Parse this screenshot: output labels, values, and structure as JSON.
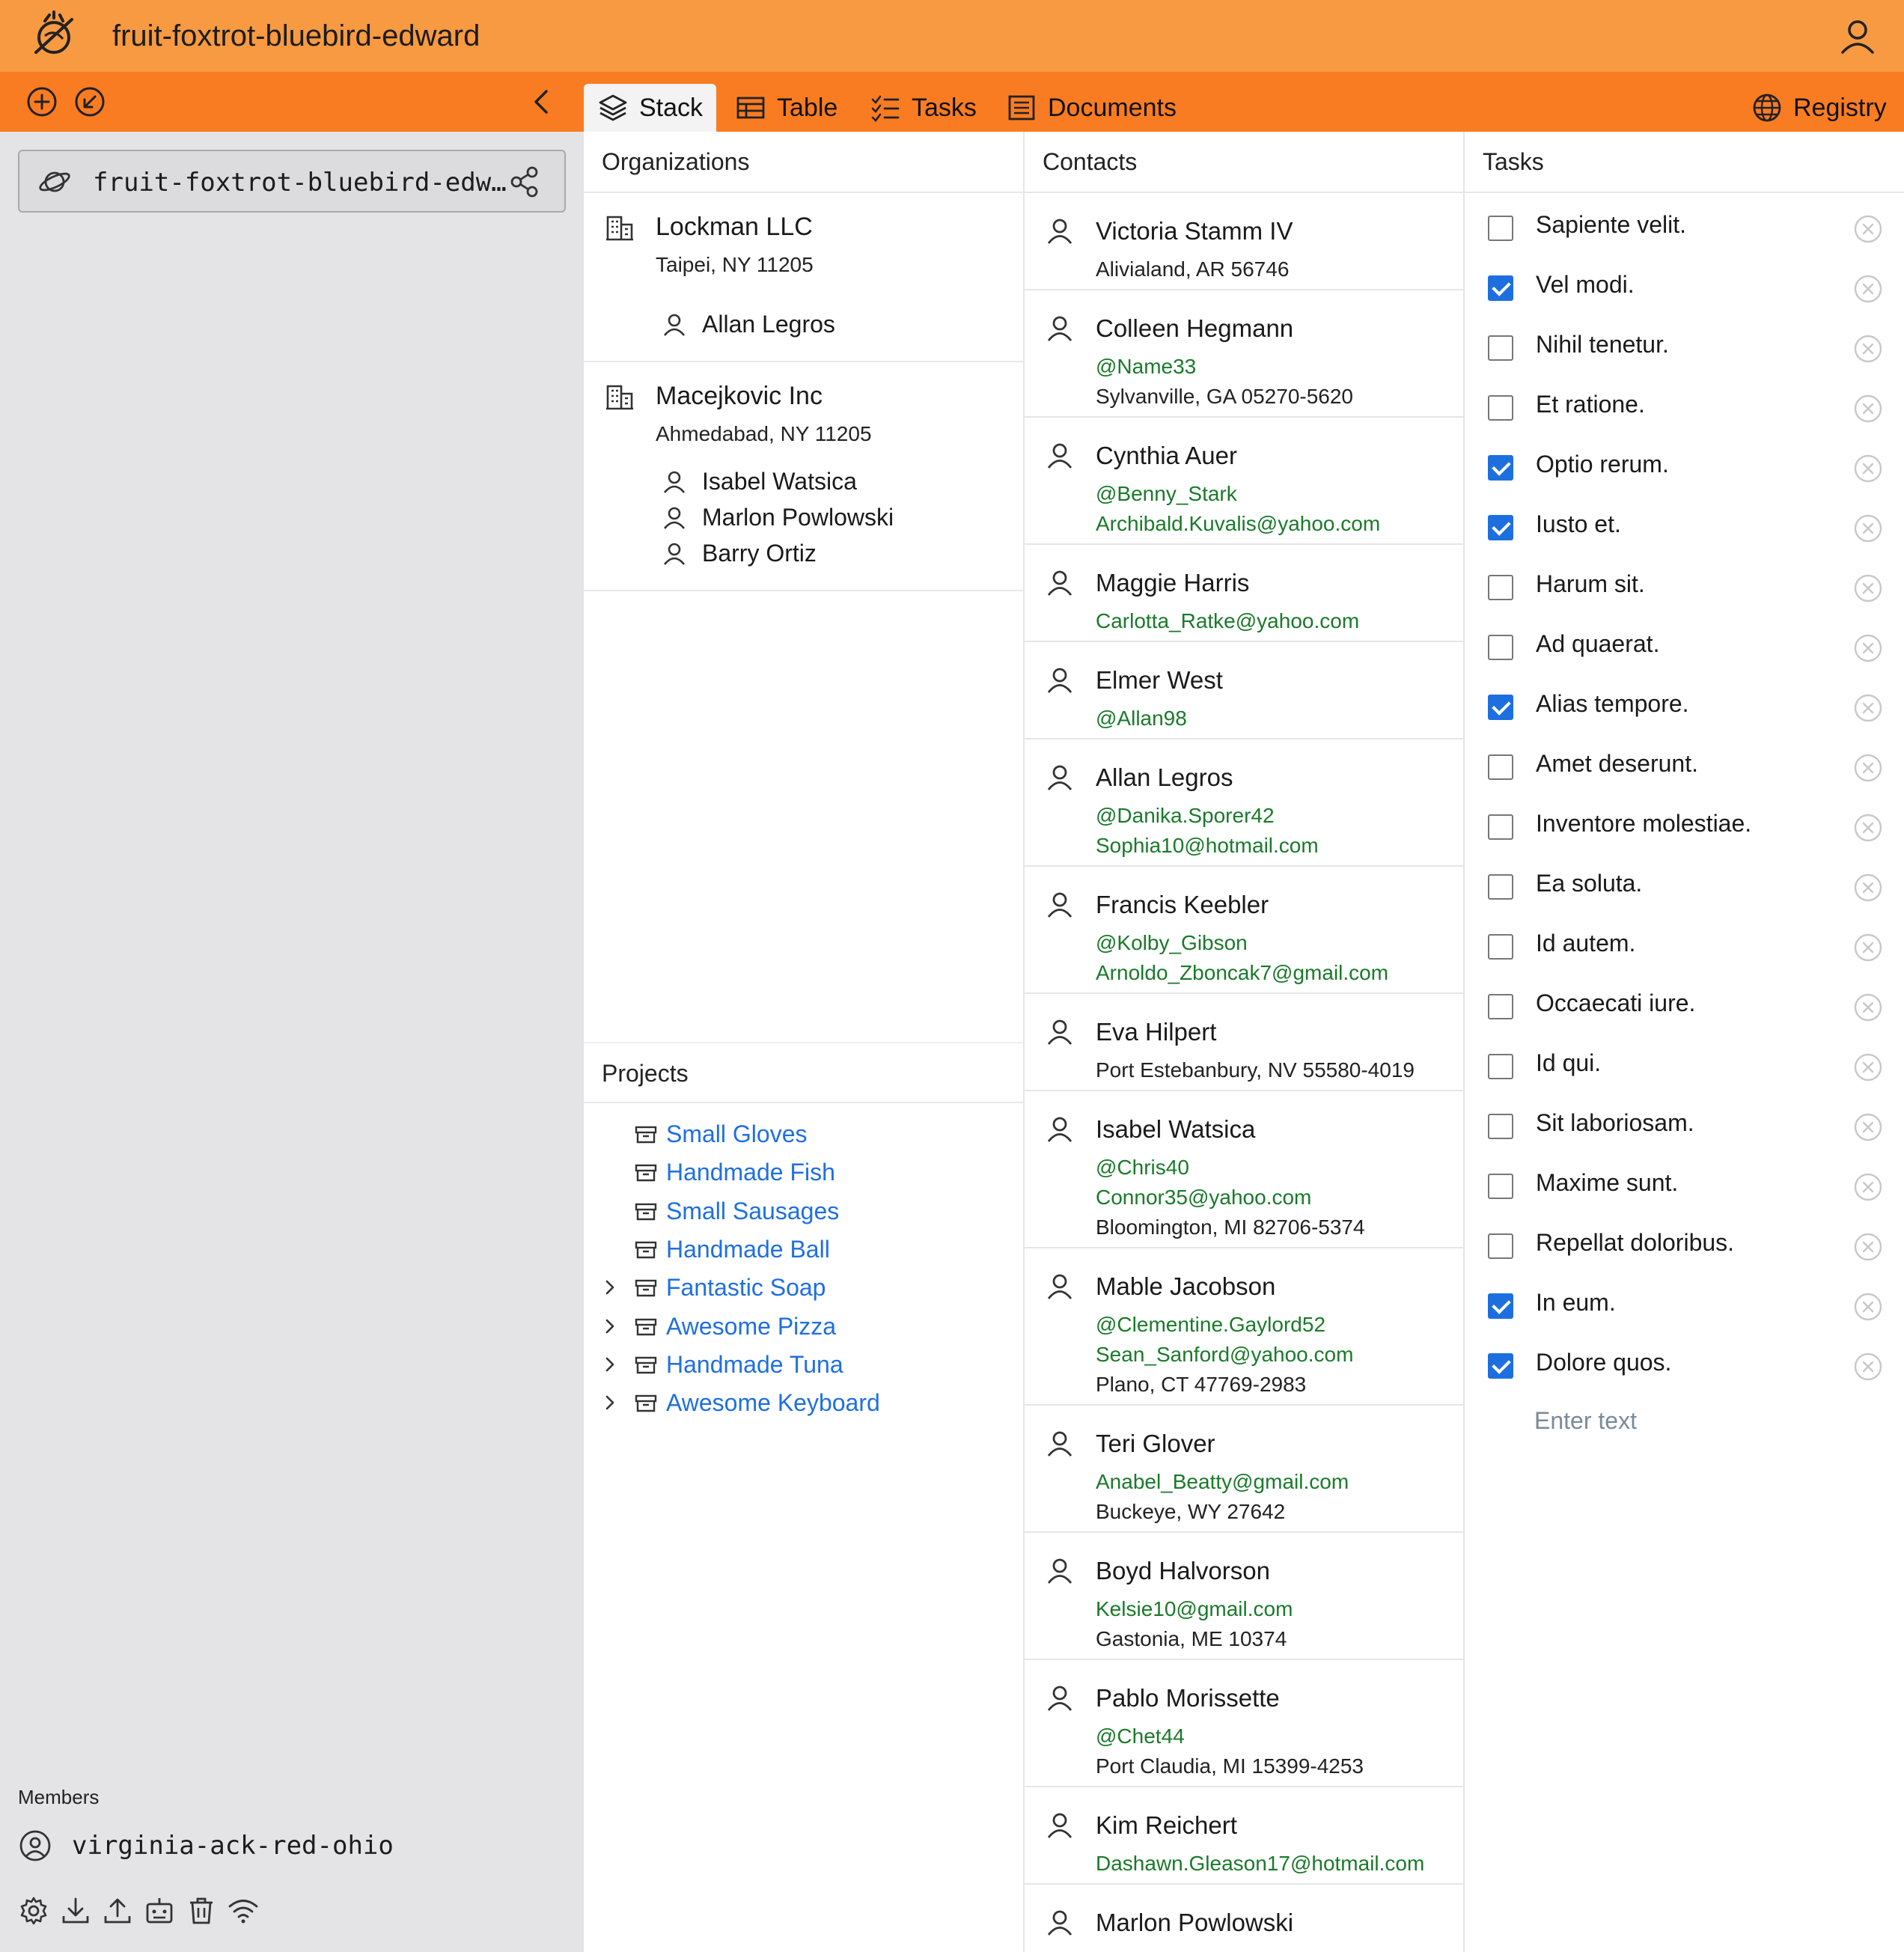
{
  "app": {
    "title": "fruit-foxtrot-bluebird-edward"
  },
  "tabs": [
    {
      "label": "Stack",
      "icon": "stack-icon",
      "active": true
    },
    {
      "label": "Table",
      "icon": "table-icon",
      "active": false
    },
    {
      "label": "Tasks",
      "icon": "checklist-icon",
      "active": false
    },
    {
      "label": "Documents",
      "icon": "document-icon",
      "active": false
    }
  ],
  "registry": {
    "label": "Registry",
    "icon": "globe-icon"
  },
  "sidebar": {
    "space_name": "fruit-foxtrot-bluebird-edw…",
    "members_label": "Members",
    "member": "virginia-ack-red-ohio"
  },
  "organizations": {
    "header": "Organizations",
    "items": [
      {
        "name": "Lockman LLC",
        "address": "Taipei, NY 11205",
        "people": [
          "Allan Legros"
        ]
      },
      {
        "name": "Macejkovic Inc",
        "address": "Ahmedabad, NY 11205",
        "people": [
          "Isabel Watsica",
          "Marlon Powlowski",
          "Barry Ortiz"
        ]
      }
    ]
  },
  "projects": {
    "header": "Projects",
    "items": [
      {
        "name": "Small Gloves",
        "expandable": false
      },
      {
        "name": "Handmade Fish",
        "expandable": false
      },
      {
        "name": "Small Sausages",
        "expandable": false
      },
      {
        "name": "Handmade Ball",
        "expandable": false
      },
      {
        "name": "Fantastic Soap",
        "expandable": true
      },
      {
        "name": "Awesome Pizza",
        "expandable": true
      },
      {
        "name": "Handmade Tuna",
        "expandable": true
      },
      {
        "name": "Awesome Keyboard",
        "expandable": true
      }
    ]
  },
  "contacts": {
    "header": "Contacts",
    "items": [
      {
        "name": "Victoria Stamm IV",
        "lines": [
          {
            "text": "Alivialand, AR 56746",
            "kind": "plain"
          }
        ]
      },
      {
        "name": "Colleen Hegmann",
        "lines": [
          {
            "text": "@Name33",
            "kind": "grn"
          },
          {
            "text": "Sylvanville, GA 05270-5620",
            "kind": "plain"
          }
        ]
      },
      {
        "name": "Cynthia Auer",
        "lines": [
          {
            "text": "@Benny_Stark",
            "kind": "grn"
          },
          {
            "text": "Archibald.Kuvalis@yahoo.com",
            "kind": "grn"
          }
        ]
      },
      {
        "name": "Maggie Harris",
        "lines": [
          {
            "text": "Carlotta_Ratke@yahoo.com",
            "kind": "grn"
          }
        ]
      },
      {
        "name": "Elmer West",
        "lines": [
          {
            "text": "@Allan98",
            "kind": "grn"
          }
        ]
      },
      {
        "name": "Allan Legros",
        "lines": [
          {
            "text": "@Danika.Sporer42",
            "kind": "grn"
          },
          {
            "text": "Sophia10@hotmail.com",
            "kind": "grn"
          }
        ]
      },
      {
        "name": "Francis Keebler",
        "lines": [
          {
            "text": "@Kolby_Gibson",
            "kind": "grn"
          },
          {
            "text": "Arnoldo_Zboncak7@gmail.com",
            "kind": "grn"
          }
        ]
      },
      {
        "name": "Eva Hilpert",
        "lines": [
          {
            "text": "Port Estebanbury, NV 55580-4019",
            "kind": "plain"
          }
        ]
      },
      {
        "name": "Isabel Watsica",
        "lines": [
          {
            "text": "@Chris40",
            "kind": "grn"
          },
          {
            "text": "Connor35@yahoo.com",
            "kind": "grn"
          },
          {
            "text": "Bloomington, MI 82706-5374",
            "kind": "plain"
          }
        ]
      },
      {
        "name": "Mable Jacobson",
        "lines": [
          {
            "text": "@Clementine.Gaylord52",
            "kind": "grn"
          },
          {
            "text": "Sean_Sanford@yahoo.com",
            "kind": "grn"
          },
          {
            "text": "Plano, CT 47769-2983",
            "kind": "plain"
          }
        ]
      },
      {
        "name": "Teri Glover",
        "lines": [
          {
            "text": "Anabel_Beatty@gmail.com",
            "kind": "grn"
          },
          {
            "text": "Buckeye, WY 27642",
            "kind": "plain"
          }
        ]
      },
      {
        "name": "Boyd Halvorson",
        "lines": [
          {
            "text": "Kelsie10@gmail.com",
            "kind": "grn"
          },
          {
            "text": "Gastonia, ME 10374",
            "kind": "plain"
          }
        ]
      },
      {
        "name": "Pablo Morissette",
        "lines": [
          {
            "text": "@Chet44",
            "kind": "grn"
          },
          {
            "text": "Port Claudia, MI 15399-4253",
            "kind": "plain"
          }
        ]
      },
      {
        "name": "Kim Reichert",
        "lines": [
          {
            "text": "Dashawn.Gleason17@hotmail.com",
            "kind": "grn"
          }
        ]
      },
      {
        "name": "Marlon Powlowski",
        "lines": []
      }
    ]
  },
  "tasks": {
    "header": "Tasks",
    "input_placeholder": "Enter text",
    "items": [
      {
        "text": "Sapiente velit.",
        "done": false
      },
      {
        "text": "Vel modi.",
        "done": true
      },
      {
        "text": "Nihil tenetur.",
        "done": false
      },
      {
        "text": "Et ratione.",
        "done": false
      },
      {
        "text": "Optio rerum.",
        "done": true
      },
      {
        "text": "Iusto et.",
        "done": true
      },
      {
        "text": "Harum sit.",
        "done": false
      },
      {
        "text": "Ad quaerat.",
        "done": false
      },
      {
        "text": "Alias tempore.",
        "done": true
      },
      {
        "text": "Amet deserunt.",
        "done": false
      },
      {
        "text": "Inventore molestiae.",
        "done": false
      },
      {
        "text": "Ea soluta.",
        "done": false
      },
      {
        "text": "Id autem.",
        "done": false
      },
      {
        "text": "Occaecati iure.",
        "done": false
      },
      {
        "text": "Id qui.",
        "done": false
      },
      {
        "text": "Sit laboriosam.",
        "done": false
      },
      {
        "text": "Maxime sunt.",
        "done": false
      },
      {
        "text": "Repellat doloribus.",
        "done": false
      },
      {
        "text": "In eum.",
        "done": true
      },
      {
        "text": "Dolore quos.",
        "done": true
      }
    ]
  },
  "colors": {
    "topbar": "#f79a42",
    "navbar": "#f97c22",
    "link_blue": "#1f6fe0",
    "contact_green": "#1a7a2a",
    "checkbox_blue": "#1d6fe0"
  }
}
